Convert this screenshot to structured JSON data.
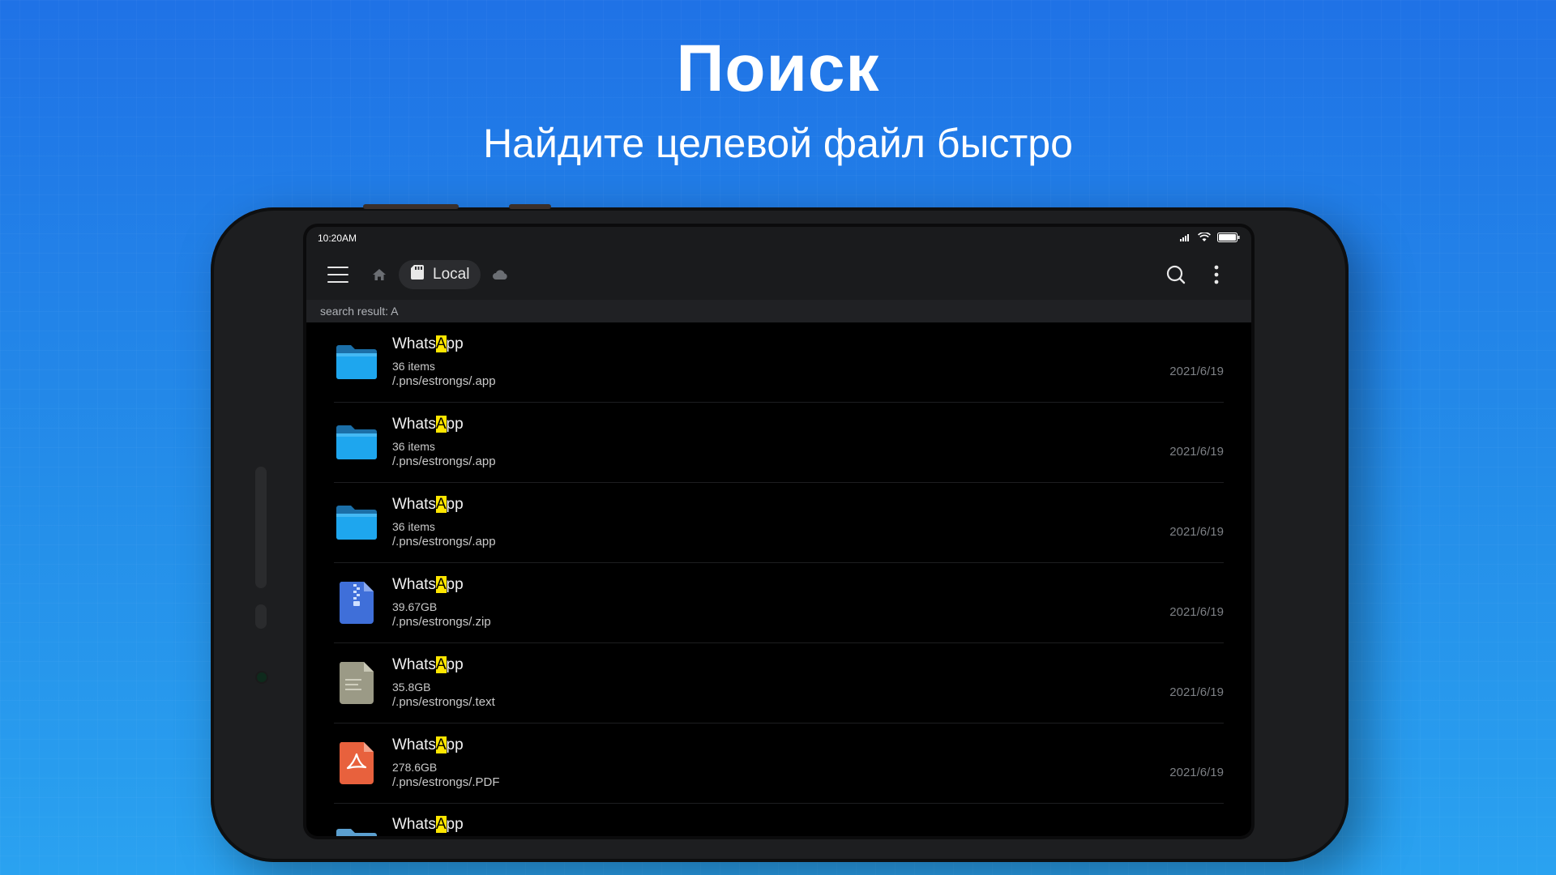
{
  "promo": {
    "title": "Поиск",
    "subtitle": "Найдите целевой файл быстро"
  },
  "status_bar": {
    "time": "10:20AM",
    "icons": [
      "signal-icon",
      "wifi-icon",
      "battery-icon"
    ]
  },
  "app_bar": {
    "menu_icon": "menu-icon",
    "home_icon": "home-icon",
    "location_chip": "Local",
    "cloud_icon": "cloud-icon",
    "search_icon": "search-icon",
    "more_icon": "more-vertical-icon"
  },
  "search": {
    "label": "search result:  A"
  },
  "results": [
    {
      "name_pre": "Whats",
      "name_hl": "A",
      "name_post": "pp",
      "info": "36 items",
      "path": "/.pns/estrongs/.app",
      "date": "2021/6/19",
      "type": "folder"
    },
    {
      "name_pre": "Whats",
      "name_hl": "A",
      "name_post": "pp",
      "info": "36 items",
      "path": "/.pns/estrongs/.app",
      "date": "2021/6/19",
      "type": "folder"
    },
    {
      "name_pre": "Whats",
      "name_hl": "A",
      "name_post": "pp",
      "info": "36 items",
      "path": "/.pns/estrongs/.app",
      "date": "2021/6/19",
      "type": "folder"
    },
    {
      "name_pre": "Whats",
      "name_hl": "A",
      "name_post": "pp",
      "info": "39.67GB",
      "path": "/.pns/estrongs/.zip",
      "date": "2021/6/19",
      "type": "zip"
    },
    {
      "name_pre": "Whats",
      "name_hl": "A",
      "name_post": "pp",
      "info": "35.8GB",
      "path": "/.pns/estrongs/.text",
      "date": "2021/6/19",
      "type": "text"
    },
    {
      "name_pre": "Whats",
      "name_hl": "A",
      "name_post": "pp",
      "info": "278.6GB",
      "path": "/.pns/estrongs/.PDF",
      "date": "2021/6/19",
      "type": "pdf"
    },
    {
      "name_pre": "Whats",
      "name_hl": "A",
      "name_post": "pp",
      "type": "folder-light"
    }
  ],
  "colors": {
    "background_top": "#1f72e6",
    "background_bottom": "#2aa2f0",
    "highlight": "#ffe600",
    "folder": "#1aa3ec",
    "zip": "#3d6fd8",
    "text_file": "#9a9a84",
    "pdf": "#e8603c"
  }
}
